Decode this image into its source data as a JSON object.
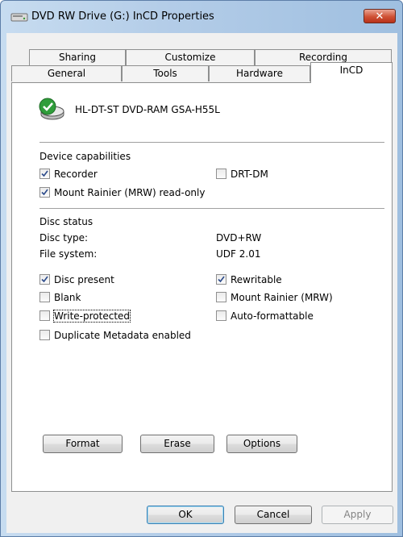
{
  "window": {
    "title": "DVD RW Drive (G:) InCD Properties"
  },
  "tabs": {
    "row1": [
      "Sharing",
      "Customize",
      "Recording"
    ],
    "row2": [
      "General",
      "Tools",
      "Hardware"
    ],
    "active": "InCD"
  },
  "device": {
    "name": "HL-DT-ST DVD-RAM GSA-H55L"
  },
  "capabilities": {
    "heading": "Device capabilities",
    "recorder": {
      "label": "Recorder",
      "checked": true
    },
    "drt_dm": {
      "label": "DRT-DM",
      "checked": false
    },
    "mount_rainier_ro": {
      "label": "Mount Rainier (MRW) read-only",
      "checked": true
    }
  },
  "disc": {
    "heading": "Disc status",
    "type_label": "Disc type:",
    "type_value": "DVD+RW",
    "fs_label": "File system:",
    "fs_value": "UDF 2.01",
    "present": {
      "label": "Disc present",
      "checked": true
    },
    "rewritable": {
      "label": "Rewritable",
      "checked": true
    },
    "blank": {
      "label": "Blank",
      "checked": false
    },
    "mount_rainier": {
      "label": "Mount Rainier (MRW)",
      "checked": false
    },
    "write_protected": {
      "label": "Write-protected",
      "checked": false
    },
    "auto_formattable": {
      "label": "Auto-formattable",
      "checked": false
    },
    "duplicate_metadata": {
      "label": "Duplicate Metadata enabled",
      "checked": false
    }
  },
  "actions": {
    "format": "Format",
    "erase": "Erase",
    "options": "Options"
  },
  "footer": {
    "ok": "OK",
    "cancel": "Cancel",
    "apply": "Apply"
  }
}
